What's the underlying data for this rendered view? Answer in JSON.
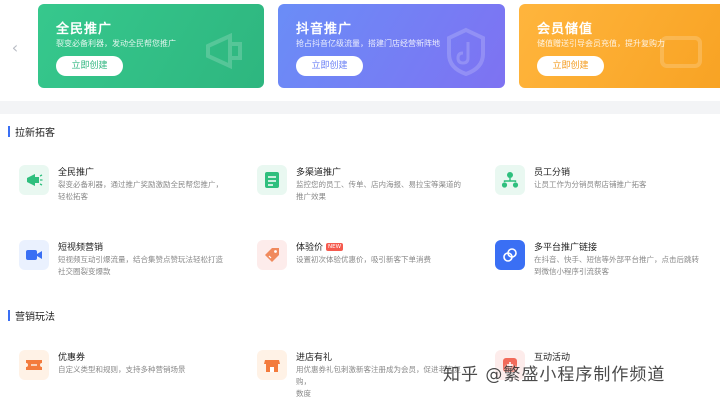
{
  "banners": [
    {
      "title": "全民推广",
      "desc": "裂变必备利器，发动全民帮您推广",
      "button": "立即创建"
    },
    {
      "title": "抖音推广",
      "desc": "抢占抖音亿级流量，搭建门店经营新阵地",
      "button": "立即创建"
    },
    {
      "title": "会员储值",
      "desc": "储值赠送引导会员充值，提升复购力",
      "button": "立即创建"
    }
  ],
  "sections": [
    {
      "title": "拉新拓客",
      "items": [
        {
          "name": "全民推广",
          "desc": "裂变必备利器，通过推广奖励激励全民帮您推广，轻松拓客",
          "icon": "megaphone-icon"
        },
        {
          "name": "多渠道推广",
          "desc": "监控您的员工、传单、店内海报、易拉宝等渠道的推广效果",
          "icon": "document-icon"
        },
        {
          "name": "员工分销",
          "desc": "让员工作为分销员帮店铺推广拓客",
          "icon": "org-chart-icon"
        },
        {
          "name": "短视频营销",
          "desc": "短视频互动引爆流量，结合集赞点赞玩法轻松打造社交圈裂变爆款",
          "icon": "video-icon"
        },
        {
          "name": "体验价",
          "badge": "NEW",
          "desc": "设置初次体验优惠价，吸引新客下单消费",
          "icon": "tag-icon"
        },
        {
          "name": "多平台推广链接",
          "desc": "在抖音、快手、短信等外部平台推广，点击后跳转到微信小程序引流获客",
          "icon": "link-icon"
        }
      ]
    },
    {
      "title": "营销玩法",
      "items": [
        {
          "name": "优惠券",
          "desc": "自定义类型和规则，支持多种营销场景",
          "icon": "coupon-icon"
        },
        {
          "name": "进店有礼",
          "desc": "用优惠券礼包刺激新客注册成为会员，促进老客复购，",
          "desc2": "数度",
          "icon": "shop-gift-icon"
        },
        {
          "name": "互动活动",
          "desc": "",
          "icon": "interactive-icon"
        }
      ]
    }
  ],
  "watermark": "知乎 @繁盛小程序制作频道",
  "colors": {
    "accent": "#3a6ff4",
    "green": "#2eb67f",
    "blue": "#6a8df7",
    "orange": "#f8a324"
  }
}
